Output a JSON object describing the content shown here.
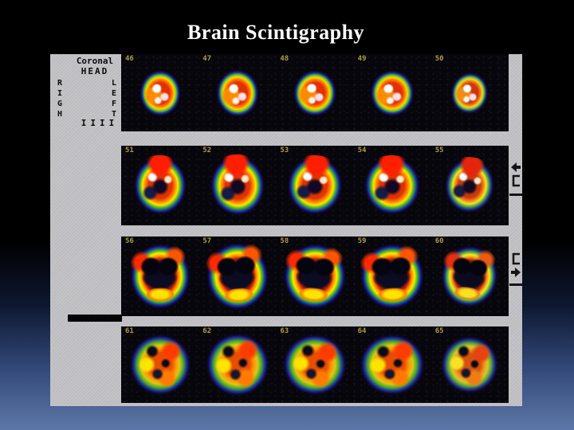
{
  "slide": {
    "title": "Brain Scintigraphy"
  },
  "panel": {
    "header": {
      "line1": "Coronal",
      "line2": "HEAD"
    },
    "orientation": {
      "left_letters": [
        "R",
        "I",
        "G",
        "H"
      ],
      "right_letters": [
        "L",
        "E",
        "F",
        "T"
      ],
      "ticks": "IIII"
    },
    "rows": [
      {
        "frames": [
          "46",
          "47",
          "48",
          "49",
          "50"
        ]
      },
      {
        "frames": [
          "51",
          "52",
          "53",
          "54",
          "55"
        ]
      },
      {
        "frames": [
          "56",
          "57",
          "58",
          "59",
          "60"
        ]
      },
      {
        "frames": [
          "61",
          "62",
          "63",
          "64",
          "65"
        ]
      }
    ],
    "markers": [
      {
        "icon": "arrow-left-bracket-icon"
      },
      {
        "icon": "arrow-right-bracket-icon"
      }
    ]
  },
  "colors": {
    "title_text": "#ffffff",
    "background_top": "#000000",
    "background_bottom": "#5d78a8",
    "panel_background": "#c3c3c7",
    "strip_background": "#06060b",
    "frame_number": "#ad9f3d"
  }
}
